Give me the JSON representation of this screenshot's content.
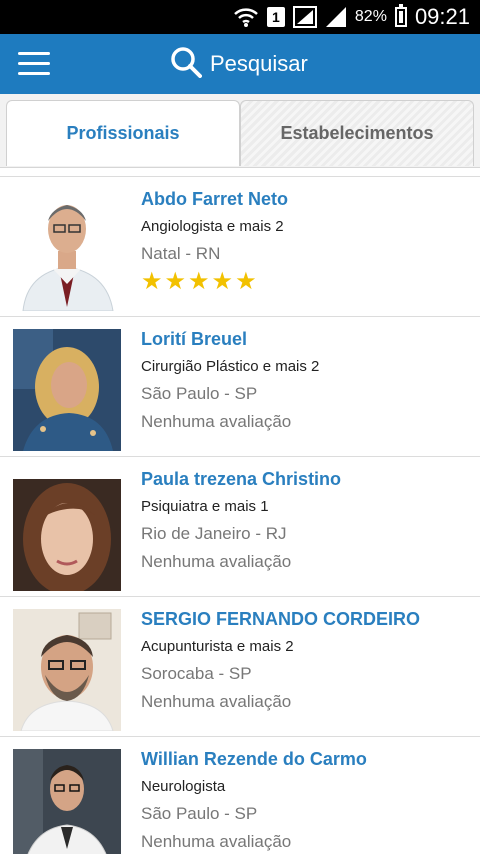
{
  "status_bar": {
    "sim_slot": "1",
    "battery": "82%",
    "time": "09:21"
  },
  "app_bar": {
    "search_label": "Pesquisar"
  },
  "tabs": [
    {
      "label": "Profissionais",
      "active": true
    },
    {
      "label": "Estabelecimentos",
      "active": false
    }
  ],
  "professionals": [
    {
      "name": "Abdo Farret Neto",
      "specialty": "Angiologista e mais 2",
      "city": "Natal - RN",
      "rating_text": "",
      "stars": "★★★★★",
      "rating": 5
    },
    {
      "name": "Lorití Breuel",
      "specialty": "Cirurgião Plástico e mais 2",
      "city": "São Paulo - SP",
      "rating_text": "Nenhuma avaliação",
      "stars": ""
    },
    {
      "name": "Paula trezena Christino",
      "specialty": "Psiquiatra e mais 1",
      "city": "Rio de Janeiro - RJ",
      "rating_text": "Nenhuma avaliação",
      "stars": ""
    },
    {
      "name": "SERGIO FERNANDO CORDEIRO",
      "specialty": "Acupunturista e mais 2",
      "city": "Sorocaba - SP",
      "rating_text": "Nenhuma avaliação",
      "stars": ""
    },
    {
      "name": "Willian Rezende do Carmo",
      "specialty": "Neurologista",
      "city": "São Paulo - SP",
      "rating_text": "Nenhuma avaliação",
      "stars": ""
    }
  ],
  "colors": {
    "app_bar": "#1e7bbf",
    "accent": "#2a7fbf",
    "star": "#f2c100"
  }
}
